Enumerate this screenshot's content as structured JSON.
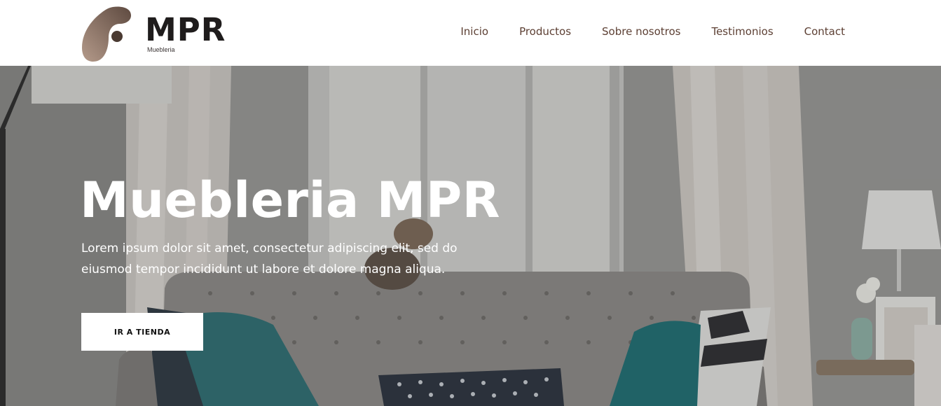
{
  "brand": {
    "name": "MPR",
    "subtitle": "Muebleria",
    "logo_icon": "brand-logo-mark",
    "colors": {
      "logo_dark": "#5e4a40",
      "logo_light": "#b49a8a",
      "text": "#1f1c1c"
    }
  },
  "nav": {
    "items": [
      {
        "label": "Inicio"
      },
      {
        "label": "Productos"
      },
      {
        "label": "Sobre nosotros"
      },
      {
        "label": "Testimonios"
      },
      {
        "label": "Contact"
      }
    ],
    "color": "#5c3f33"
  },
  "hero": {
    "title": "Muebleria MPR",
    "description": "Lorem ipsum dolor sit amet, consectetur adipiscing elit, sed do eiusmod tempor incididunt ut labore et dolore magna aliqua.",
    "cta_label": "IR A TIENDA",
    "background": "living-room-sofa-photo"
  }
}
